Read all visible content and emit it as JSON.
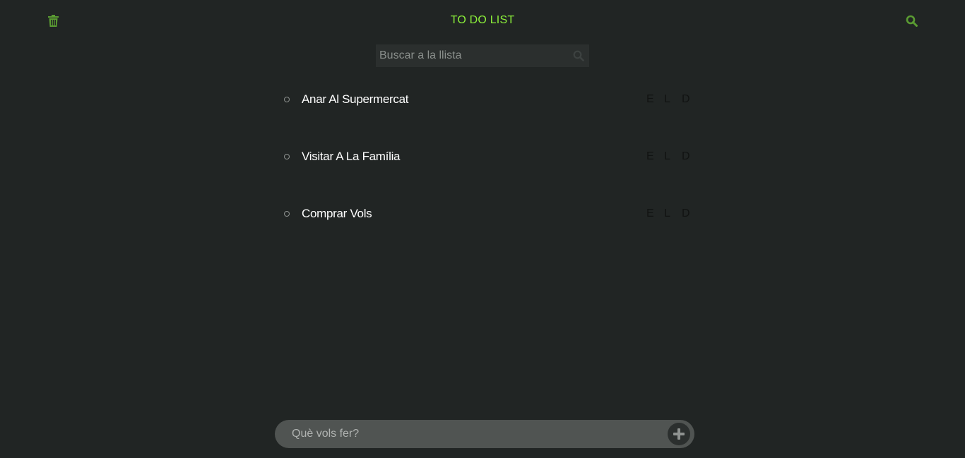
{
  "header": {
    "title": "TO DO LIST",
    "trash_icon": "trash-icon",
    "search_icon": "search-icon",
    "accent_color": "#8cf13a",
    "icon_color": "#5a9b32"
  },
  "search": {
    "placeholder": "Buscar a la llista",
    "value": ""
  },
  "todos": [
    {
      "label": "Anar Al Supermercat",
      "actions": [
        "E",
        "L",
        "D"
      ]
    },
    {
      "label": "Visitar A La Família",
      "actions": [
        "E",
        "L",
        "D"
      ]
    },
    {
      "label": "Comprar Vols",
      "actions": [
        "E",
        "L",
        "D"
      ]
    }
  ],
  "add_bar": {
    "placeholder": "Què vols fer?",
    "value": "",
    "add_icon": "plus-icon"
  }
}
